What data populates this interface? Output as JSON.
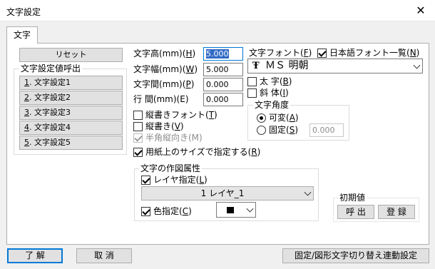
{
  "window": {
    "title": "文字設定",
    "close_glyph": "✕"
  },
  "tab": {
    "label": "文字"
  },
  "reset_button": "リセット",
  "preset_group": {
    "label": "文字設定値呼出",
    "items": [
      {
        "num": "1",
        "text": ". 文字設定1"
      },
      {
        "num": "2",
        "text": ". 文字設定2"
      },
      {
        "num": "3",
        "text": ". 文字設定3"
      },
      {
        "num": "4",
        "text": ". 文字設定4"
      },
      {
        "num": "5",
        "text": ". 文字設定5"
      }
    ]
  },
  "fields": {
    "height": {
      "label_pre": "文字高(mm)(",
      "key": "H",
      "label_post": ")",
      "value": "5.000"
    },
    "width": {
      "label_pre": "文字幅(mm)(",
      "key": "W",
      "label_post": ")",
      "value": "5.000"
    },
    "spacing": {
      "label_pre": "文字間(mm)(",
      "key": "P",
      "label_post": ")",
      "value": "0.000"
    },
    "line": {
      "label": "行 間(mm)(E)",
      "value": "0.000"
    }
  },
  "checks": {
    "vertical_font": {
      "pre": "縦書きフォント(",
      "key": "T",
      "post": ")",
      "checked": false
    },
    "vertical": {
      "pre": "縦書き(",
      "key": "V",
      "post": ")",
      "checked": false
    },
    "halfwidth": {
      "label": "半角縦向き(M)",
      "checked": true
    },
    "paper_size": {
      "pre": "用紙上のサイズで指定する(",
      "key": "R",
      "post": ")",
      "checked": true
    }
  },
  "font": {
    "label_pre": "文字フォント(",
    "key": "F",
    "label_post": ")",
    "jp_list": {
      "pre": "日本語フォント一覧(",
      "key": "N",
      "post": ")",
      "checked": true
    },
    "selected_icon": "Ŧ",
    "selected": "ＭＳ 明朝",
    "bold": {
      "pre": "太 字(",
      "key": "B",
      "post": ")",
      "checked": false
    },
    "italic": {
      "pre": "斜 体(",
      "key": "I",
      "post": ")",
      "checked": false
    }
  },
  "angle": {
    "label": "文字角度",
    "variable": {
      "pre": "可変(",
      "key": "A",
      "post": ")",
      "checked": true
    },
    "fixed": {
      "pre": "固定(",
      "key": "S",
      "post": ")",
      "checked": false
    },
    "value": "0.000"
  },
  "draw_attr": {
    "label": "文字の作図属性",
    "layer": {
      "pre": "レイヤ指定(",
      "key": "L",
      "post": ")",
      "checked": true,
      "selected": "1 レイヤ_1"
    },
    "color": {
      "pre": "色指定(",
      "key": "C",
      "post": ")",
      "checked": true,
      "swatch": "#000000"
    }
  },
  "initial": {
    "label": "初期値",
    "load": "呼 出",
    "save": "登 録"
  },
  "footer": {
    "ok": "了 解",
    "cancel": "取 消",
    "link": "固定/図形文字切り替え連動設定"
  }
}
